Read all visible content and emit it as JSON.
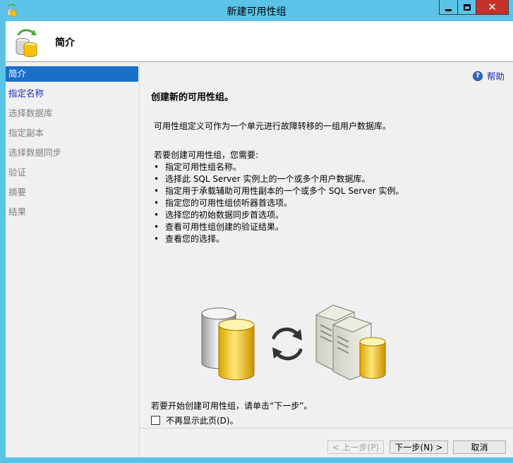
{
  "window": {
    "title": "新建可用性组",
    "close_glyph": "✕"
  },
  "header": {
    "title": "简介"
  },
  "sidebar": {
    "items": [
      {
        "label": "简介",
        "state": "active"
      },
      {
        "label": "指定名称",
        "state": "link"
      },
      {
        "label": "选择数据库",
        "state": "disabled"
      },
      {
        "label": "指定副本",
        "state": "disabled"
      },
      {
        "label": "选择数据同步",
        "state": "disabled"
      },
      {
        "label": "验证",
        "state": "disabled"
      },
      {
        "label": "摘要",
        "state": "disabled"
      },
      {
        "label": "结果",
        "state": "disabled"
      }
    ]
  },
  "main": {
    "help_label": "帮助",
    "heading": "创建新的可用性组。",
    "intro": "可用性组定义可作为一个单元进行故障转移的一组用户数据库。",
    "requirements_title": "若要创建可用性组，您需要:",
    "requirements": [
      "指定可用性组名称。",
      "选择此 SQL Server 实例上的一个或多个用户数据库。",
      "指定用于承载辅助可用性副本的一个或多个 SQL Server 实例。",
      "指定您的可用性组侦听器首选项。",
      "选择您的初始数据同步首选项。",
      "查看可用性组创建的验证结果。",
      "查看您的选择。"
    ],
    "start_text": "若要开始创建可用性组，请单击“下一步”。",
    "dont_show_label": "不再显示此页(D)。",
    "dont_show_checked": false
  },
  "footer": {
    "prev_label": "< 上一步(P)",
    "next_label": "下一步(N) >",
    "cancel_label": "取消"
  },
  "colors": {
    "titlebar": "#5bc3e8",
    "close": "#c7312b",
    "selection": "#1a6fc9",
    "link": "#1a2bb8"
  }
}
